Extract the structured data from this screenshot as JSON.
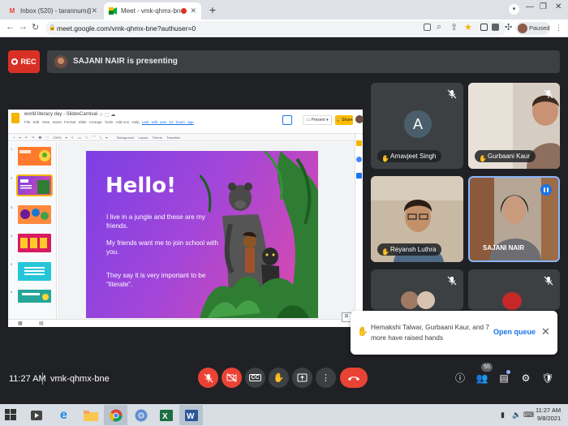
{
  "browser": {
    "tabs": [
      {
        "title": "Inbox (520) - tarannum@theindi",
        "icon": "gmail-icon"
      },
      {
        "title": "Meet - vmk-qhmx-bne",
        "icon": "meet-icon"
      }
    ],
    "url": "meet.google.com/vmk-qhmx-bne?authuser=0",
    "profile_label": "Paused"
  },
  "meet": {
    "rec_label": "REC",
    "presenting_text": "SAJANI NAIR is presenting",
    "meeting_time": "11:27 AM",
    "meeting_code": "vmk-qhmx-bne",
    "participants_count": "55",
    "accent": "#ea4335"
  },
  "shared_screen": {
    "doc_title": "world literacy day - SlidesCarnival",
    "menu": [
      "File",
      "Edit",
      "View",
      "Insert",
      "Format",
      "Slide",
      "Arrange",
      "Tools",
      "Add-ons",
      "Help"
    ],
    "last_edit": "Last edit was 12 hours ago",
    "present_label": "Present",
    "share_label": "Share",
    "toolbar": "Background  Layout  Theme  Transition",
    "thumb_numbers": [
      "1",
      "2",
      "3",
      "4",
      "5",
      "6"
    ],
    "slide": {
      "title": "Hello!",
      "p1": "I live in a jungle and these are my friends.",
      "p2": "My friends want me to join school with you.",
      "p3": "They say it is very important to be “literate”.",
      "number": "2"
    }
  },
  "tiles": [
    {
      "name": "Arnavjeet Singh",
      "initial": "A"
    },
    {
      "name": "Gurbaani Kaur"
    },
    {
      "name": "Reyansh Luthra"
    },
    {
      "name": "SAJANI NAIR"
    }
  ],
  "notification": {
    "text": "Hemakshi Talwar, Gurbaani Kaur, and 7 more have raised hands",
    "button": "Open queue"
  },
  "taskbar": {
    "time": "11:27 AM",
    "date": "9/8/2021"
  }
}
